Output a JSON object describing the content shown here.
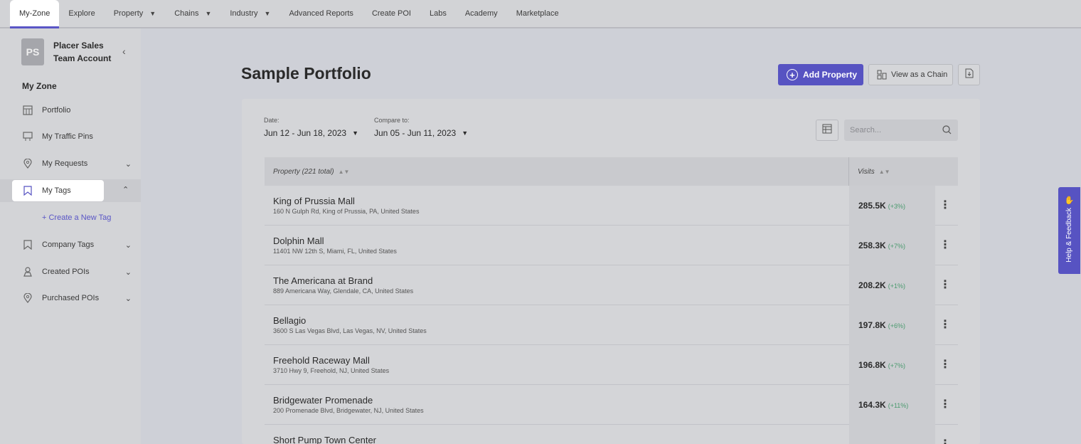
{
  "nav": {
    "tabs": [
      {
        "label": "My-Zone",
        "active": true,
        "dropdown": false
      },
      {
        "label": "Explore",
        "dropdown": false
      },
      {
        "label": "Property",
        "dropdown": true
      },
      {
        "label": "Chains",
        "dropdown": true
      },
      {
        "label": "Industry",
        "dropdown": true
      },
      {
        "label": "Advanced Reports",
        "dropdown": false
      },
      {
        "label": "Create POI",
        "dropdown": false
      },
      {
        "label": "Labs",
        "dropdown": false
      },
      {
        "label": "Academy",
        "dropdown": false
      },
      {
        "label": "Marketplace",
        "dropdown": false
      }
    ]
  },
  "sidebar": {
    "avatar_initials": "PS",
    "account_name": "Placer Sales Team Account",
    "section_title": "My Zone",
    "items": [
      {
        "label": "Portfolio",
        "icon": "portfolio-icon"
      },
      {
        "label": "My Traffic Pins",
        "icon": "traffic-pin-icon"
      },
      {
        "label": "My Requests",
        "icon": "location-pin-icon",
        "expand": "down"
      },
      {
        "label": "My Tags",
        "icon": "tag-icon",
        "expand": "up",
        "active": true
      },
      {
        "label": "Company Tags",
        "icon": "tag-icon",
        "expand": "down"
      },
      {
        "label": "Created POIs",
        "icon": "created-poi-icon",
        "expand": "down"
      },
      {
        "label": "Purchased POIs",
        "icon": "location-pin-icon",
        "expand": "down"
      }
    ],
    "create_tag_label": "+ Create a New Tag"
  },
  "main": {
    "title": "Sample Portfolio",
    "add_property_label": "Add Property",
    "view_chain_label": "View as a Chain",
    "date_label": "Date:",
    "date_value": "Jun 12 - Jun 18, 2023",
    "compare_label": "Compare to:",
    "compare_value": "Jun 05 - Jun 11, 2023",
    "search_placeholder": "Search..."
  },
  "table": {
    "col_property": "Property (221 total)",
    "col_visits": "Visits",
    "rows": [
      {
        "name": "King of Prussia Mall",
        "address": "160 N Gulph Rd, King of Prussia, PA, United States",
        "visits": "285.5K",
        "change": "(+3%)"
      },
      {
        "name": "Dolphin Mall",
        "address": "11401 NW 12th S, Miami, FL, United States",
        "visits": "258.3K",
        "change": "(+7%)"
      },
      {
        "name": "The Americana at Brand",
        "address": "889 Americana Way, Glendale, CA, United States",
        "visits": "208.2K",
        "change": "(+1%)"
      },
      {
        "name": "Bellagio",
        "address": "3600 S Las Vegas Blvd, Las Vegas, NV, United States",
        "visits": "197.8K",
        "change": "(+6%)"
      },
      {
        "name": "Freehold Raceway Mall",
        "address": "3710 Hwy 9, Freehold, NJ, United States",
        "visits": "196.8K",
        "change": "(+7%)"
      },
      {
        "name": "Bridgewater Promenade",
        "address": "200 Promenade Blvd, Bridgewater, NJ, United States",
        "visits": "164.3K",
        "change": "(+11%)"
      },
      {
        "name": "Short Pump Town Center",
        "address": "",
        "visits": "",
        "change": ""
      }
    ]
  },
  "feedback": {
    "label": "Help & Feedback"
  },
  "colors": {
    "accent": "#5753c2",
    "positive": "#4a9a6e"
  }
}
